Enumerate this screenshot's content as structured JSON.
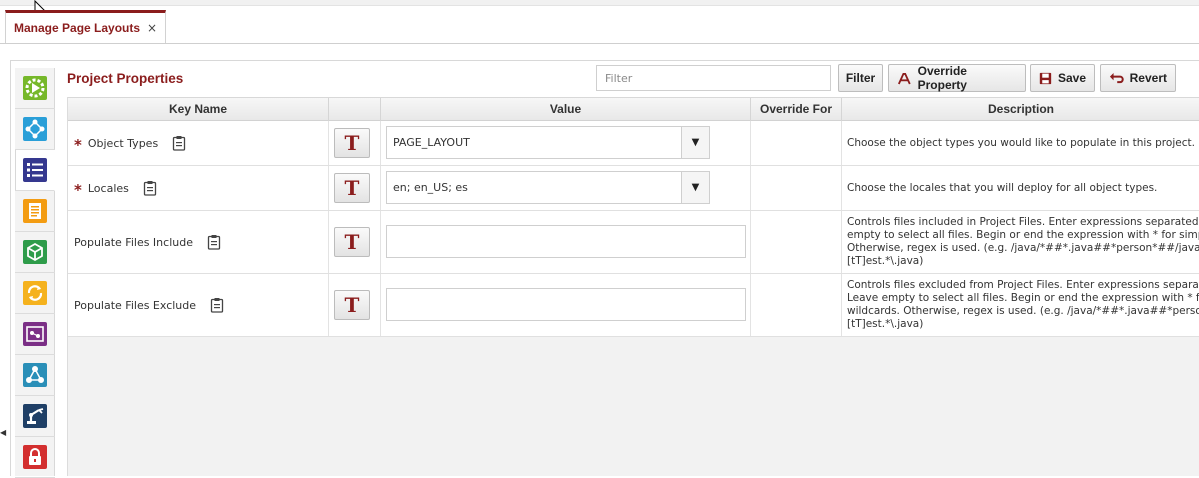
{
  "tab": {
    "label": "Manage Page Layouts",
    "close": "×"
  },
  "sidebar": {
    "items": [
      {
        "icon": "play-gear-icon",
        "color": "#76b82a"
      },
      {
        "icon": "network-nodes-icon",
        "color": "#2a9fd8"
      },
      {
        "icon": "list-icon",
        "color": "#35388f",
        "active": true
      },
      {
        "icon": "document-icon",
        "color": "#f39c12"
      },
      {
        "icon": "box-icon",
        "color": "#2e9c4a"
      },
      {
        "icon": "refresh-icon",
        "color": "#f5b21e"
      },
      {
        "icon": "workflow-board-icon",
        "color": "#7b2f86"
      },
      {
        "icon": "hierarchy-icon",
        "color": "#2a8fb8"
      },
      {
        "icon": "robot-arm-icon",
        "color": "#1f3f66"
      },
      {
        "icon": "lock-icon",
        "color": "#d32f2f"
      }
    ]
  },
  "toolbar": {
    "title": "Project Properties",
    "filter_placeholder": "Filter",
    "filter_button": "Filter",
    "override_button": "Override Property",
    "save_button": "Save",
    "revert_button": "Revert"
  },
  "table": {
    "headers": {
      "key": "Key Name",
      "type": "",
      "value": "Value",
      "override": "Override For",
      "description": "Description"
    },
    "rows": [
      {
        "required": "*",
        "key": "Object Types",
        "type_glyph": "T",
        "value": "PAGE_LAYOUT",
        "control": "select",
        "override": "",
        "description": [
          "Choose the object types you would like to populate in this project."
        ]
      },
      {
        "required": "*",
        "key": "Locales",
        "type_glyph": "T",
        "value": "en; en_US; es",
        "control": "select",
        "override": "",
        "description": [
          "Choose the locales that you will deploy for all object types."
        ]
      },
      {
        "required": "",
        "key": "Populate Files Include",
        "type_glyph": "T",
        "value": "",
        "control": "text",
        "override": "",
        "description": [
          "Controls files included in Project Files. Enter expressions separated b",
          "empty to select all files. Begin or end the expression with * for simpl",
          "Otherwise, regex is used. (e.g. /java/*##*.java##*person*##/java",
          "[tT]est.*\\.java)"
        ]
      },
      {
        "required": "",
        "key": "Populate Files Exclude",
        "type_glyph": "T",
        "value": "",
        "control": "text",
        "override": "",
        "description": [
          "Controls files excluded from Project Files. Enter expressions separate",
          "Leave empty to select all files. Begin or end the expression with * fo",
          "wildcards. Otherwise, regex is used. (e.g. /java/*##*.java##*perso",
          "[tT]est.*\\.java)"
        ]
      }
    ]
  },
  "colors": {
    "accent": "#8b1d1d"
  }
}
